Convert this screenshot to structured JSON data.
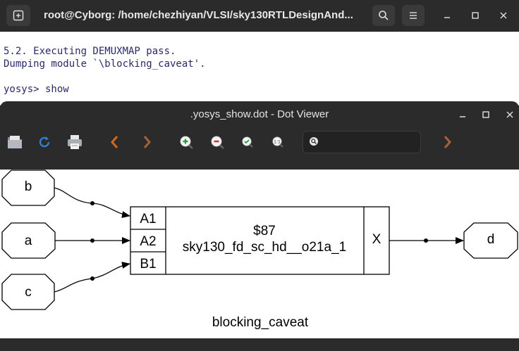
{
  "terminal": {
    "title": "root@Cyborg: /home/chezhiyan/VLSI/sky130RTLDesignAnd...",
    "lines": [
      "5.2. Executing DEMUXMAP pass.",
      "Dumping module `\\blocking_caveat'.",
      "",
      "yosys> show"
    ]
  },
  "viewer": {
    "title": ".yosys_show.dot - Dot Viewer",
    "find_value": ""
  },
  "graph": {
    "inputs": [
      "b",
      "a",
      "c"
    ],
    "output": "d",
    "cell": {
      "ports_in": [
        "A1",
        "A2",
        "B1"
      ],
      "id": "$87",
      "type": "sky130_fd_sc_hd__o21a_1",
      "port_out": "X"
    },
    "module_name": "blocking_caveat"
  },
  "colors": {
    "terminal_titlebar": "#2b2b2b",
    "viewer_chrome": "#2b2b2b",
    "terminal_text": "#2a2a6a",
    "nav_arrow": "#d2691e",
    "reload": "#2f7fd6"
  }
}
